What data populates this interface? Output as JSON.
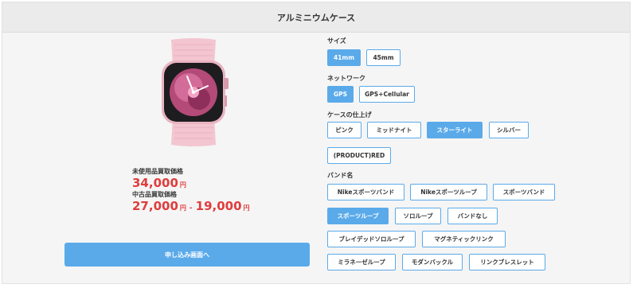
{
  "header": {
    "title": "アルミニウムケース"
  },
  "product": {
    "image_icon": "apple-watch-pink-icon"
  },
  "prices": {
    "new_label": "未使用品買取価格",
    "new_price": "34,000",
    "yen": "円",
    "used_label": "中古品買取価格",
    "used_max": "27,000",
    "tilde": "-",
    "used_min": "19,000"
  },
  "apply_button": {
    "label": "申し込み画面へ"
  },
  "options": {
    "size": {
      "title": "サイズ",
      "items": [
        "41mm",
        "45mm"
      ],
      "selected": "41mm"
    },
    "network": {
      "title": "ネットワーク",
      "items": [
        "GPS",
        "GPS+Cellular"
      ],
      "selected": "GPS"
    },
    "finish": {
      "title": "ケースの仕上げ",
      "items": [
        "ピンク",
        "ミッドナイト",
        "スターライト",
        "シルバー",
        "(PRODUCT)RED"
      ],
      "selected": "スターライト"
    },
    "band": {
      "title": "バンド名",
      "items": [
        "Nikeスポーツバンド",
        "Nikeスポーツループ",
        "スポーツバンド",
        "スポーツループ",
        "ソロループ",
        "バンドなし",
        "ブレイデッドソロループ",
        "マグネティックリンク",
        "ミラネーゼループ",
        "モダンバックル",
        "リンクブレスレット"
      ],
      "selected": "スポーツループ"
    }
  },
  "colors": {
    "accent": "#5aaaea",
    "price": "#e03c3c",
    "band_pink": "#f2c2cf"
  }
}
